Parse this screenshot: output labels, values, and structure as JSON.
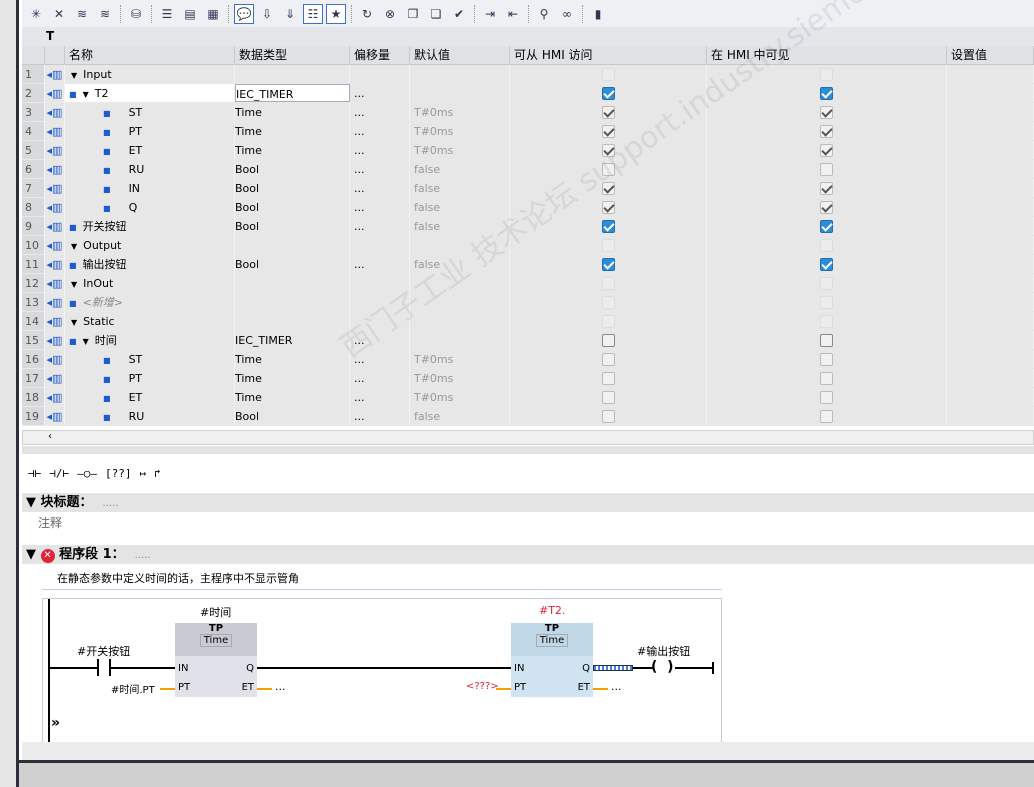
{
  "toolbar": {
    "icons": [
      "insert-row-icon",
      "add-row-icon",
      "insert-multi-icon",
      "add-multi-icon",
      "db-icon",
      "lines-icon",
      "network-icon",
      "network2-icon",
      "comment-icon",
      "download-icon",
      "watch-download-icon",
      "list-icon",
      "favorite-icon",
      "reset-icon",
      "delete-icon",
      "copy-icon",
      "copy2-icon",
      "check-icon",
      "indent-icon",
      "indent2-icon",
      "monitor-icon",
      "glasses-icon",
      "split-icon"
    ]
  },
  "block_name": "T",
  "table": {
    "headers": [
      "名称",
      "数据类型",
      "偏移量",
      "默认值",
      "可从 HMI 访问",
      "在 HMI 中可见",
      "设置值"
    ],
    "rows": [
      {
        "n": "1",
        "name": "Input",
        "level": 0,
        "tri": true,
        "type": "",
        "off": "",
        "def": "",
        "a": "dis",
        "v": "dis"
      },
      {
        "n": "2",
        "name": "T2",
        "level": 1,
        "tri": true,
        "bullet": true,
        "type": "IEC_TIMER",
        "off": "...",
        "def": "",
        "a": "blue",
        "v": "blue",
        "sel": true
      },
      {
        "n": "3",
        "name": "ST",
        "level": 2,
        "bullet": true,
        "type": "Time",
        "off": "...",
        "def": "T#0ms",
        "a": "chk",
        "v": "chk"
      },
      {
        "n": "4",
        "name": "PT",
        "level": 2,
        "bullet": true,
        "type": "Time",
        "off": "...",
        "def": "T#0ms",
        "a": "chk",
        "v": "chk"
      },
      {
        "n": "5",
        "name": "ET",
        "level": 2,
        "bullet": true,
        "type": "Time",
        "off": "...",
        "def": "T#0ms",
        "a": "chk",
        "v": "chk"
      },
      {
        "n": "6",
        "name": "RU",
        "level": 2,
        "bullet": true,
        "type": "Bool",
        "off": "...",
        "def": "false",
        "a": "",
        "v": ""
      },
      {
        "n": "7",
        "name": "IN",
        "level": 2,
        "bullet": true,
        "type": "Bool",
        "off": "...",
        "def": "false",
        "a": "chk",
        "v": "chk"
      },
      {
        "n": "8",
        "name": "Q",
        "level": 2,
        "bullet": true,
        "type": "Bool",
        "off": "...",
        "def": "false",
        "a": "chk",
        "v": "chk"
      },
      {
        "n": "9",
        "name": "开关按钮",
        "level": 1,
        "bullet": true,
        "type": "Bool",
        "off": "...",
        "def": "false",
        "a": "blue",
        "v": "blue"
      },
      {
        "n": "10",
        "name": "Output",
        "level": 0,
        "tri": true,
        "type": "",
        "off": "",
        "def": "",
        "a": "dis",
        "v": "dis"
      },
      {
        "n": "11",
        "name": "输出按钮",
        "level": 1,
        "bullet": true,
        "type": "Bool",
        "off": "...",
        "def": "false",
        "a": "blue",
        "v": "blue"
      },
      {
        "n": "12",
        "name": "InOut",
        "level": 0,
        "tri": true,
        "type": "",
        "off": "",
        "def": "",
        "a": "dis",
        "v": "dis"
      },
      {
        "n": "13",
        "name": "<新增>",
        "level": 1,
        "bullet": true,
        "type": "",
        "off": "",
        "def": "",
        "a": "dis",
        "v": "dis"
      },
      {
        "n": "14",
        "name": "Static",
        "level": 0,
        "tri": true,
        "type": "",
        "off": "",
        "def": "",
        "a": "dis",
        "v": "dis"
      },
      {
        "n": "15",
        "name": "时间",
        "level": 1,
        "tri": true,
        "bullet": true,
        "type": "IEC_TIMER",
        "off": "...",
        "def": "",
        "a": "en",
        "v": "en"
      },
      {
        "n": "16",
        "name": "ST",
        "level": 2,
        "bullet": true,
        "type": "Time",
        "off": "...",
        "def": "T#0ms",
        "a": "",
        "v": ""
      },
      {
        "n": "17",
        "name": "PT",
        "level": 2,
        "bullet": true,
        "type": "Time",
        "off": "...",
        "def": "T#0ms",
        "a": "",
        "v": ""
      },
      {
        "n": "18",
        "name": "ET",
        "level": 2,
        "bullet": true,
        "type": "Time",
        "off": "...",
        "def": "T#0ms",
        "a": "",
        "v": ""
      },
      {
        "n": "19",
        "name": "RU",
        "level": 2,
        "bullet": true,
        "type": "Bool",
        "off": "...",
        "def": "false",
        "a": "",
        "v": ""
      }
    ]
  },
  "ladder_toolbar": [
    "⊣⊢",
    "⊣/⊢",
    "–○–",
    "[??]",
    "↦",
    "↱"
  ],
  "block_title": {
    "label": "块标题：",
    "dots": "....."
  },
  "block_comment": "注释",
  "network": {
    "label": "程序段 1：",
    "dots": ".....",
    "comment": "在静态参数中定义时间的话，主程序中不显示管角",
    "contact": "#开关按钮",
    "coil": "#输出按钮",
    "tp1": {
      "instance": "#时间",
      "name": "TP",
      "type": "Time",
      "in": "IN",
      "q": "Q",
      "pt": "PT",
      "et": "ET",
      "pt_val": "#时间.PT",
      "et_val": "..."
    },
    "tp2": {
      "instance": "#T2.",
      "name": "TP",
      "type": "Time",
      "in": "IN",
      "q": "Q",
      "pt": "PT",
      "et": "ET",
      "pt_val": "<???>",
      "et_val": "..."
    }
  },
  "watermark": "西门子工业 技术论坛 support.industry.siemens.com/cs",
  "colors": {
    "error": "#e0223a",
    "checkbox_blue": "#2d8ed8"
  }
}
